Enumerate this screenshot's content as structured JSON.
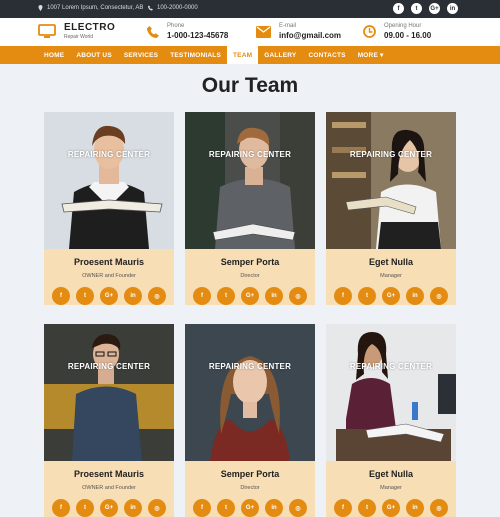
{
  "topbar": {
    "address": "1007 Lorem Ipsum, Consectetur, AB",
    "phone": "100-2000-0000",
    "social": [
      "f",
      "t",
      "G+",
      "in"
    ]
  },
  "header": {
    "logo_title": "ELECTRO",
    "logo_subtitle": "Repair World",
    "phone_label": "Phone",
    "phone_value": "1-000-123-45678",
    "email_label": "E-mail",
    "email_value": "info@gmail.com",
    "hours_label": "Opening Hour",
    "hours_value": "09.00 - 16.00"
  },
  "nav": [
    "HOME",
    "ABOUT US",
    "SERVICES",
    "TESTIMONIALS",
    "TEAM",
    "GALLERY",
    "CONTACTS",
    "MORE ▾"
  ],
  "page_title": "Our Team",
  "overlay_text": "REPAIRING CENTER",
  "card_social": [
    "f",
    "t",
    "G+",
    "in",
    "◎"
  ],
  "team": [
    {
      "name": "Proesent Mauris",
      "role": "OWNER and Founder"
    },
    {
      "name": "Semper Porta",
      "role": "Director"
    },
    {
      "name": "Eget Nulla",
      "role": "Manager"
    },
    {
      "name": "Proesent Mauris",
      "role": "OWNER and Founder"
    },
    {
      "name": "Semper Porta",
      "role": "Director"
    },
    {
      "name": "Eget Nulla",
      "role": "Manager"
    }
  ],
  "colors": {
    "accent": "#e48c12",
    "topbar": "#2a2e35",
    "card": "#f7deb5",
    "background": "#eef1f6"
  }
}
